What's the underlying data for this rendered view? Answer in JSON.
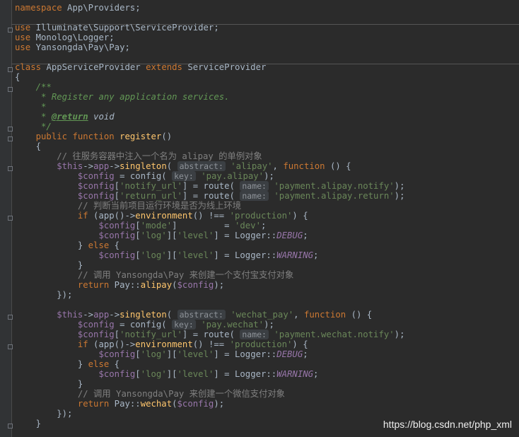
{
  "code": {
    "namespace": "App\\Providers",
    "uses": [
      "Illuminate\\Support\\ServiceProvider",
      "Monolog\\Logger",
      "Yansongda\\Pay\\Pay"
    ],
    "class_name": "AppServiceProvider",
    "parent_class": "ServiceProvider",
    "doc_line1": "* Register any application services.",
    "doc_return": "@return",
    "doc_return_type": "void",
    "method": "register",
    "comment1": "// 往服务容器中注入一个名为 alipay 的单例对象",
    "comment2": "// 判断当前项目运行环境是否为线上环境",
    "comment3": "// 调用 Yansongda\\Pay 来创建一个支付宝支付对象",
    "comment4": "// 调用 Yansongda\\Pay 来创建一个微信支付对象",
    "hint_abstract": "abstract:",
    "hint_key": "key:",
    "hint_name": "name:",
    "alipay": "'alipay'",
    "wechat": "'wechat_pay'",
    "cfg_alipay": "'pay.alipay'",
    "cfg_wechat": "'pay.wechat'",
    "route_alipay_notify": "'payment.alipay.notify'",
    "route_alipay_return": "'payment.alipay.return'",
    "route_wechat_notify": "'payment.wechat.notify'",
    "production": "'production'",
    "mode": "'mode'",
    "dev": "'dev'",
    "log": "'log'",
    "level": "'level'",
    "notify_url": "'notify_url'",
    "return_url": "'return_url'",
    "debug": "DEBUG",
    "warning": "WARNING"
  },
  "watermark": "https://blog.csdn.net/php_xml"
}
